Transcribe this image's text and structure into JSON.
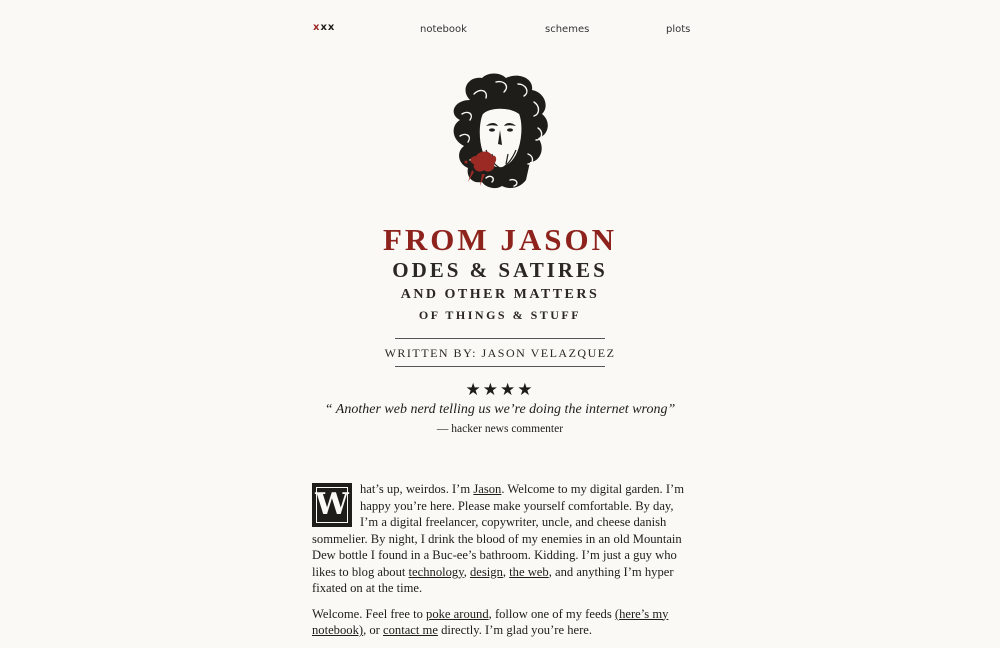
{
  "nav": {
    "logo_x1": "x",
    "logo_x2": "xx",
    "items": [
      {
        "label": "notebook"
      },
      {
        "label": "schemes"
      },
      {
        "label": "plots"
      }
    ]
  },
  "hero": {
    "title": "FROM JASON",
    "subtitle1": "ODES & SATIRES",
    "subtitle2": "AND OTHER MATTERS",
    "subtitle3": "OF THINGS & STUFF",
    "byline": "WRITTEN BY: JASON VELAZQUEZ",
    "stars": "★★★★",
    "quote": "“ Another web nerd telling us we’re doing the internet wrong”",
    "attribution": "— hacker news commenter"
  },
  "intro": {
    "dropcap": "W",
    "p1_a": "hat’s up, weirdos. I’m ",
    "link_jason": "Jason",
    "p1_b": ". Welcome to my digital garden. I’m happy you’re here. Please make yourself comfortable. By day, I’m a digital freelancer, copywriter, uncle, and cheese danish sommelier. By night, I drink the blood of my enemies in an old Mountain Dew bottle I found in a Buc-ee’s bathroom. Kidding. I’m just a guy who likes to blog about ",
    "link_technology": "technology",
    "sep1": ", ",
    "link_design": "design",
    "sep2": ", ",
    "link_web": "the web",
    "p1_c": ", and anything I’m hyper fixated on at the time.",
    "p2_a": "Welcome. Feel free to ",
    "link_poke": "poke around",
    "p2_b": ", follow one of my feeds ",
    "link_notebook": "(here’s my notebook)",
    "p2_c": ", or ",
    "link_contact": "contact me",
    "p2_d": " directly. I’m glad you’re here."
  },
  "colors": {
    "accent": "#8e231d",
    "text": "#1f1d1a",
    "background": "#faf9f6"
  },
  "icons": {
    "portrait": "medusa-woodcut-portrait"
  }
}
